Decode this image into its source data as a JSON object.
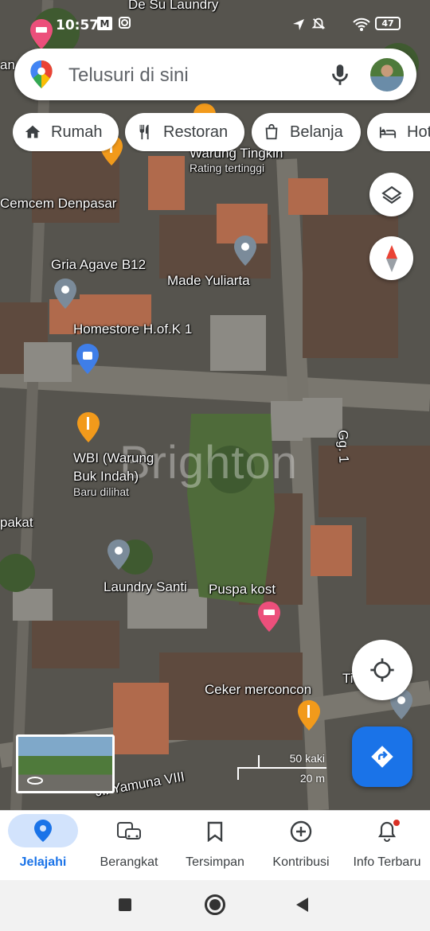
{
  "status_bar": {
    "time": "10:57",
    "mail_badge": "M",
    "battery": "47"
  },
  "search": {
    "placeholder": "Telusuri di sini",
    "pin_icon": "google-maps-pin-icon",
    "mic_icon": "mic-icon"
  },
  "chips": [
    {
      "label": "Rumah",
      "icon": "home-icon"
    },
    {
      "label": "Restoran",
      "icon": "restaurant-icon"
    },
    {
      "label": "Belanja",
      "icon": "shopping-bag-icon"
    },
    {
      "label": "Hot",
      "icon": "hotel-icon"
    }
  ],
  "map": {
    "labels": {
      "top_place": "De Su Laundry",
      "warung": "Warung Tingkih",
      "warung_sub": "Rating tertinggi",
      "cemcem": "Cemcem Denpasar",
      "gria": "Gria Agave B12",
      "made": "Made Yuliarta",
      "homestore": "Homestore H.of.K 1",
      "wbi_1": "WBI (Warung",
      "wbi_2": "Buk Indah)",
      "wbi_sub": "Baru dilihat",
      "pakat": "pakat",
      "laundry": "Laundry Santi",
      "puspa": "Puspa kost",
      "ceker": "Ceker merconcon",
      "ti": "Ti",
      "gg1": "Gg. 1",
      "yamuna": "Jl. Yamuna VIII",
      "left_edge": "an"
    },
    "watermark": "Brighton",
    "scale": {
      "imperial": "50 kaki",
      "metric": "20 m"
    }
  },
  "bottom_nav": [
    {
      "label": "Jelajahi",
      "icon": "explore-pin-icon",
      "active": true
    },
    {
      "label": "Berangkat",
      "icon": "commute-icon",
      "active": false
    },
    {
      "label": "Tersimpan",
      "icon": "bookmark-icon",
      "active": false
    },
    {
      "label": "Kontribusi",
      "icon": "add-circle-icon",
      "active": false
    },
    {
      "label": "Info Terbaru",
      "icon": "bell-icon",
      "active": false
    }
  ],
  "colors": {
    "accent": "#1a73e8",
    "active_tab_bg": "#d2e3fc",
    "notification_dot": "#d93025"
  }
}
